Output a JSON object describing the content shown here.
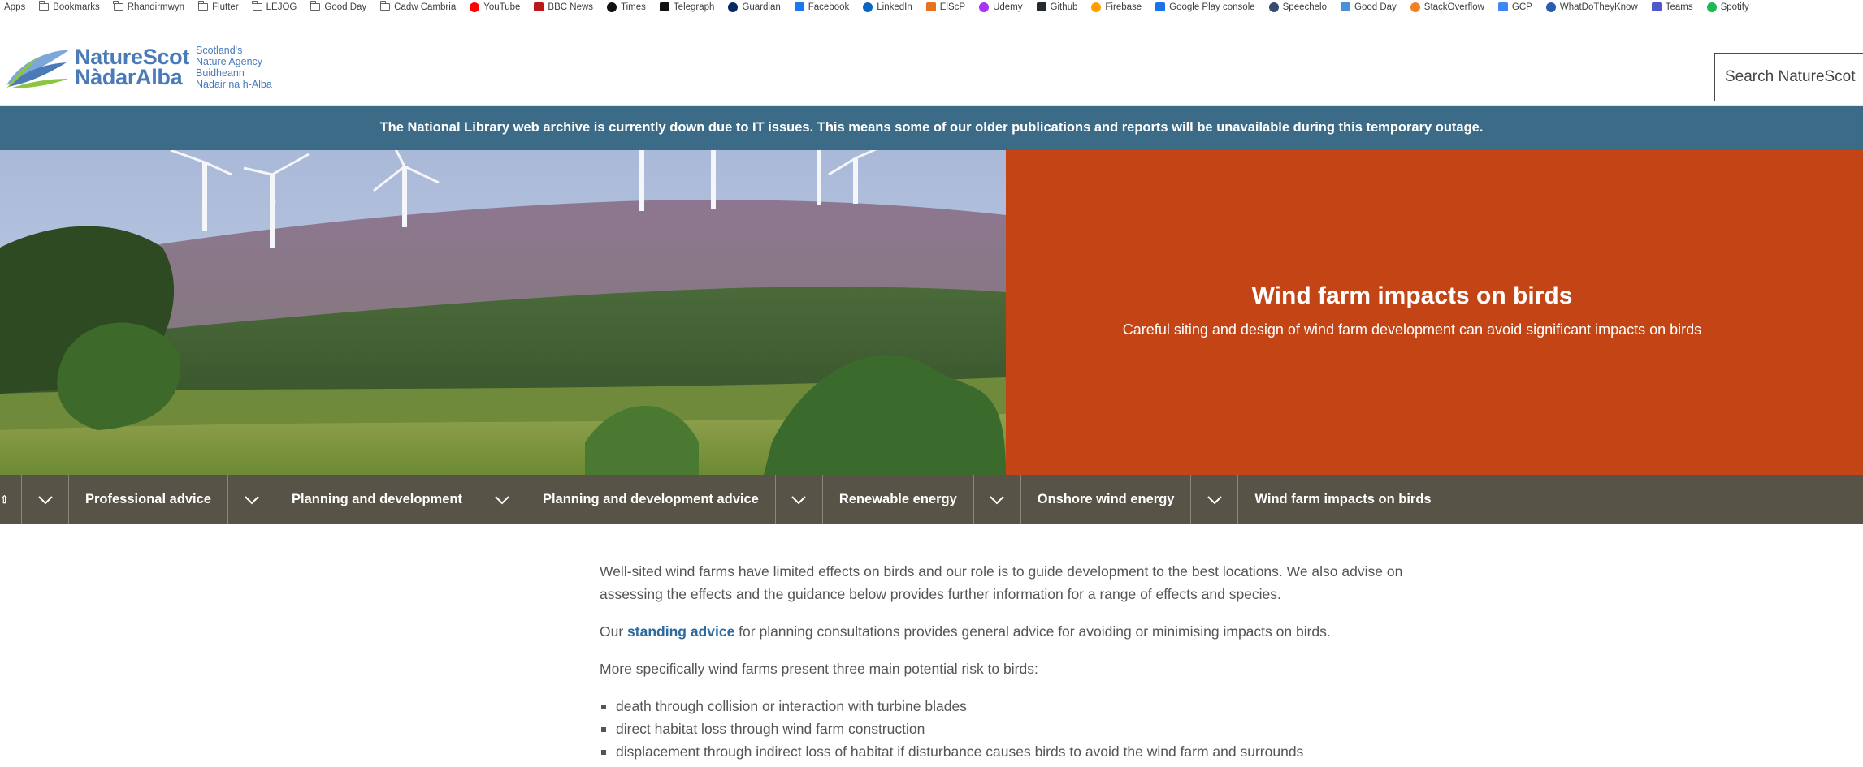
{
  "bookmarks": [
    {
      "label": "Apps",
      "icon": "apps-icon"
    },
    {
      "label": "Bookmarks",
      "icon": "folder-icon"
    },
    {
      "label": "Rhandirmwyn",
      "icon": "folder-icon"
    },
    {
      "label": "Flutter",
      "icon": "folder-icon"
    },
    {
      "label": "LEJOG",
      "icon": "folder-icon"
    },
    {
      "label": "Good Day",
      "icon": "folder-icon"
    },
    {
      "label": "Cadw Cambria",
      "icon": "folder-icon"
    },
    {
      "label": "YouTube",
      "icon": "youtube-icon",
      "color": "#ff0000"
    },
    {
      "label": "BBC News",
      "icon": "bbc-news-icon",
      "color": "#bb1919"
    },
    {
      "label": "Times",
      "icon": "times-icon",
      "color": "#111111"
    },
    {
      "label": "Telegraph",
      "icon": "telegraph-icon",
      "color": "#111111"
    },
    {
      "label": "Guardian",
      "icon": "guardian-icon",
      "color": "#052962"
    },
    {
      "label": "Facebook",
      "icon": "facebook-icon",
      "color": "#1877f2"
    },
    {
      "label": "LinkedIn",
      "icon": "linkedin-icon",
      "color": "#0a66c2"
    },
    {
      "label": "ElScP",
      "icon": "elscp-icon",
      "color": "#e8711f"
    },
    {
      "label": "Udemy",
      "icon": "udemy-icon",
      "color": "#a435f0"
    },
    {
      "label": "Github",
      "icon": "github-icon",
      "color": "#24292e"
    },
    {
      "label": "Firebase",
      "icon": "firebase-icon",
      "color": "#ffa000"
    },
    {
      "label": "Google Play console",
      "icon": "google-play-icon",
      "color": "#1a73e8"
    },
    {
      "label": "Speechelo",
      "icon": "speechelo-icon",
      "color": "#3a4a6b"
    },
    {
      "label": "Good Day",
      "icon": "good-day-icon",
      "color": "#4a90d9"
    },
    {
      "label": "StackOverflow",
      "icon": "stackoverflow-icon",
      "color": "#f48024"
    },
    {
      "label": "GCP",
      "icon": "gcp-icon",
      "color": "#4285f4"
    },
    {
      "label": "WhatDoTheyKnow",
      "icon": "whatdotheyknow-icon",
      "color": "#2a5db0"
    },
    {
      "label": "Teams",
      "icon": "teams-icon",
      "color": "#5059c9"
    },
    {
      "label": "Spotify",
      "icon": "spotify-icon",
      "color": "#1db954"
    }
  ],
  "header": {
    "logo_line1": "NatureScot",
    "logo_line2": "NàdarAlba",
    "logo_sub1": "Scotland's",
    "logo_sub2": "Nature Agency",
    "logo_sub3": "Buidheann",
    "logo_sub4": "Nàdair na h-Alba",
    "search_placeholder": "Search NatureScot",
    "brand_color": "#4a7ab8"
  },
  "alert": {
    "text": "The National Library web archive is currently down due to IT issues. This means some of our older publications and reports will be unavailable during this temporary outage.",
    "color": "#3b6b86"
  },
  "hero": {
    "title": "Wind farm impacts on birds",
    "subtitle": "Careful siting and design of wind farm development can avoid significant impacts on birds",
    "panel_color": "#c34415"
  },
  "breadcrumbs": {
    "items": [
      "Professional advice",
      "Planning and development",
      "Planning and development advice",
      "Renewable energy",
      "Onshore wind energy"
    ],
    "current": "Wind farm impacts on birds",
    "home_icon": "home-icon",
    "color": "#575447"
  },
  "content": {
    "para1": "Well-sited wind farms have limited effects on birds and our role is to guide development to the best locations. We also advise on assessing the effects and the guidance below provides further information for a range of effects and species.",
    "para2_before": "Our ",
    "para2_link": "standing advice",
    "para2_after": " for planning consultations provides general advice for avoiding or minimising impacts on birds.",
    "para3": "More specifically wind farms present three main potential risk to birds:",
    "risks": [
      "death through collision or interaction with turbine blades",
      "direct habitat loss through wind farm construction",
      "displacement through indirect loss of habitat if disturbance causes birds to avoid the wind farm and surrounds"
    ]
  }
}
